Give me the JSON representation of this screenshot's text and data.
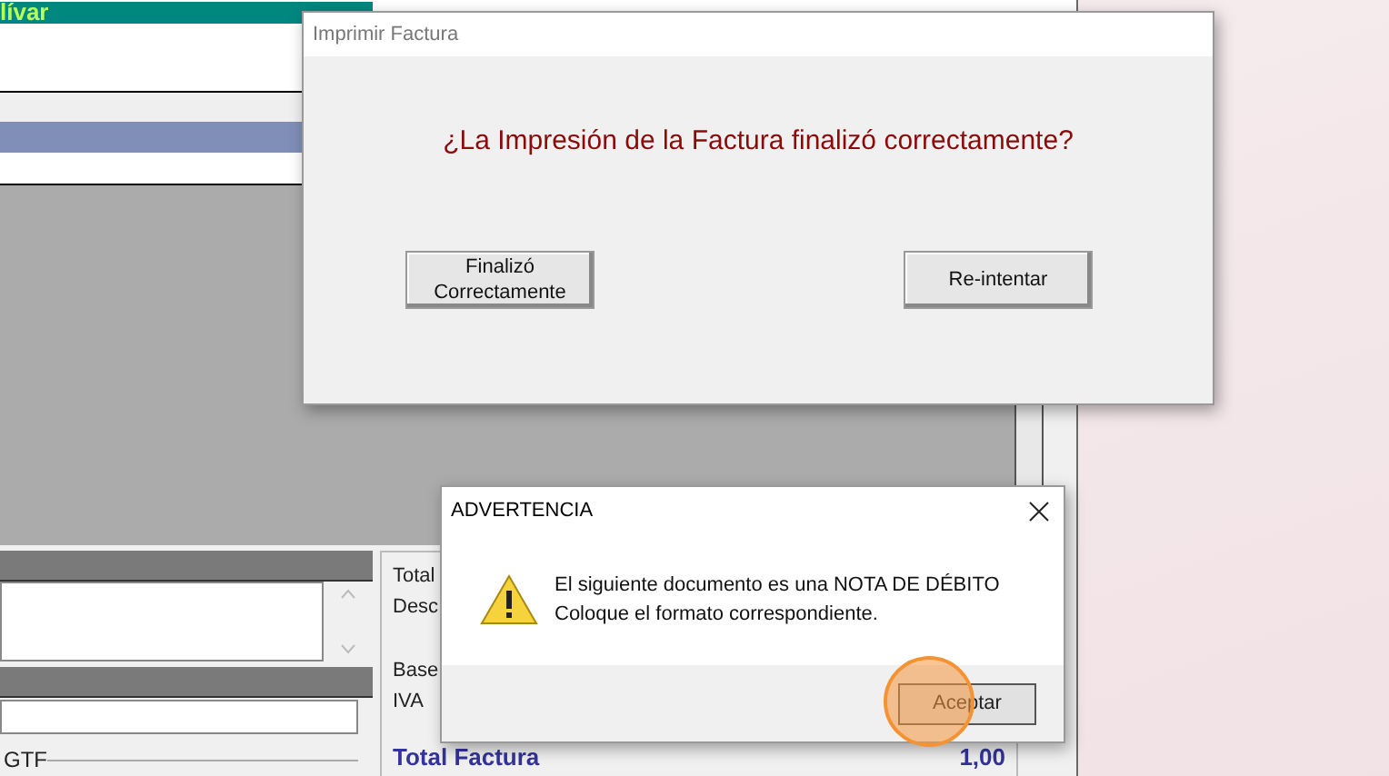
{
  "background_app": {
    "header_label": "lívar",
    "totals": [
      {
        "label": "Total"
      },
      {
        "label": "Desc"
      },
      {
        "label": "Base"
      },
      {
        "label": "IVA"
      }
    ],
    "grand_total": {
      "label": "Total Factura",
      "value": "1,00"
    },
    "gtf_group": "GTF"
  },
  "print_dialog": {
    "title": "Imprimir Factura",
    "question": "¿La Impresión de la Factura finalizó correctamente?",
    "buttons": [
      {
        "label": "Finalizó\nCorrectamente"
      },
      {
        "label": "Re-intentar"
      }
    ]
  },
  "warning_dialog": {
    "title": "ADVERTENCIA",
    "message_lines": [
      "El siguiente documento es una NOTA DE DÉBITO",
      "Coloque el formato correspondiente."
    ],
    "button": "Aceptar"
  }
}
